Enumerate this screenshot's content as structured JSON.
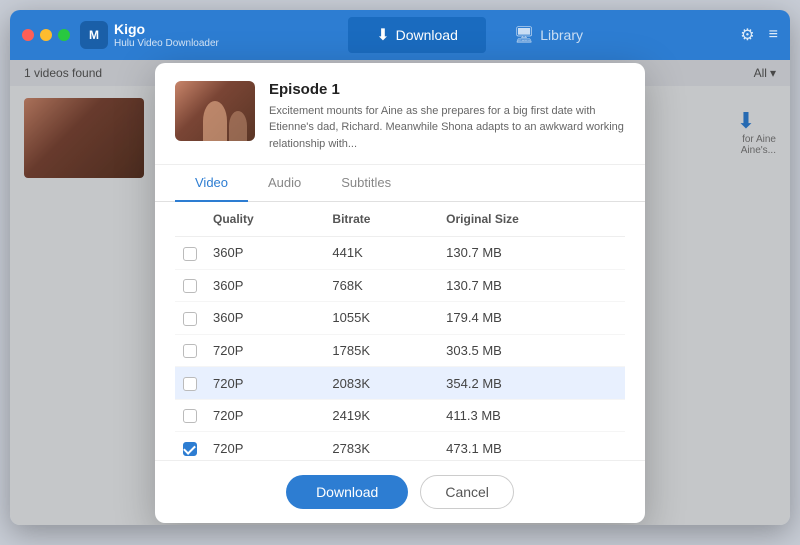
{
  "app": {
    "logo_initials": "M",
    "name": "Kigo",
    "subtitle": "Hulu Video Downloader"
  },
  "titlebar": {
    "tabs": [
      {
        "id": "download",
        "label": "Download",
        "active": true,
        "icon": "⬇"
      },
      {
        "id": "library",
        "label": "Library",
        "active": false,
        "icon": "🖥"
      }
    ],
    "settings_icon": "⚙",
    "menu_icon": "≡"
  },
  "main": {
    "videos_found": "1 videos found",
    "filter_label": "All",
    "side_text": "for Aine Aine's..."
  },
  "modal": {
    "episode_title": "Episode 1",
    "episode_description": "Excitement mounts for Aine as she prepares for a big first date with Etienne's dad, Richard. Meanwhile Shona adapts to an awkward working relationship with...",
    "format_tabs": [
      "Video",
      "Audio",
      "Subtitles"
    ],
    "active_format_tab": "Video",
    "table": {
      "headers": [
        "",
        "Quality",
        "Bitrate",
        "Original Size"
      ],
      "rows": [
        {
          "checked": false,
          "quality": "360P",
          "bitrate": "441K",
          "size": "130.7 MB",
          "truncated_top": true
        },
        {
          "checked": false,
          "quality": "360P",
          "bitrate": "768K",
          "size": "130.7 MB"
        },
        {
          "checked": false,
          "quality": "360P",
          "bitrate": "1055K",
          "size": "179.4 MB"
        },
        {
          "checked": false,
          "quality": "720P",
          "bitrate": "1785K",
          "size": "303.5 MB"
        },
        {
          "checked": false,
          "quality": "720P",
          "bitrate": "2083K",
          "size": "354.2 MB",
          "selected": true
        },
        {
          "checked": false,
          "quality": "720P",
          "bitrate": "2419K",
          "size": "411.3 MB"
        },
        {
          "checked": true,
          "quality": "720P",
          "bitrate": "2783K",
          "size": "473.1 MB"
        }
      ]
    },
    "download_btn": "Download",
    "cancel_btn": "Cancel"
  }
}
